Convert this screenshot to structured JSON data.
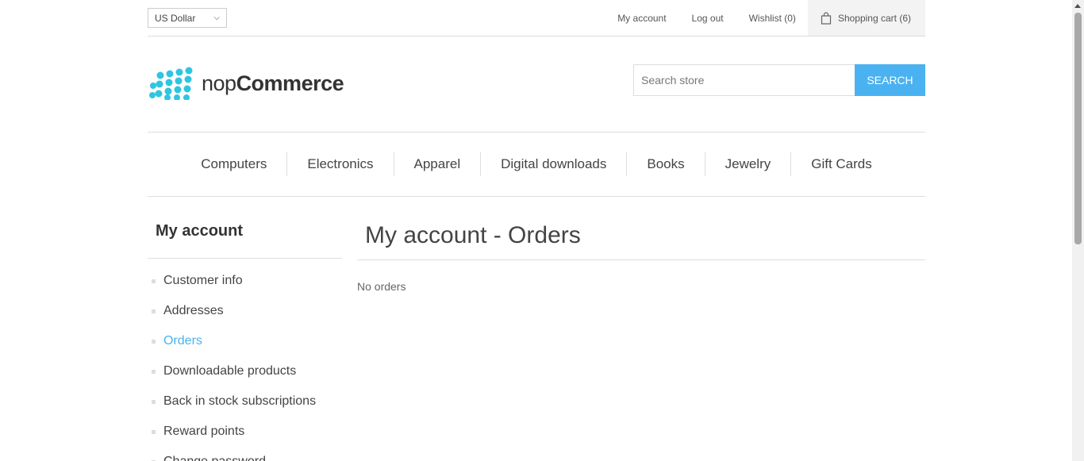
{
  "header": {
    "currency": "US Dollar",
    "links": [
      "My account",
      "Log out",
      "Wishlist (0)"
    ],
    "cart": "Shopping cart (6)"
  },
  "logo": {
    "prefix": "nop",
    "bold": "Commerce"
  },
  "search": {
    "placeholder": "Search store",
    "button": "SEARCH"
  },
  "menu": [
    "Computers",
    "Electronics",
    "Apparel",
    "Digital downloads",
    "Books",
    "Jewelry",
    "Gift Cards"
  ],
  "sidebar": {
    "title": "My account",
    "items": [
      "Customer info",
      "Addresses",
      "Orders",
      "Downloadable products",
      "Back in stock subscriptions",
      "Reward points",
      "Change password"
    ]
  },
  "main": {
    "title": "My account - Orders",
    "empty_text": "No orders"
  },
  "colors": {
    "accent": "#4ab2f1",
    "logo": "#2fc5e0"
  }
}
